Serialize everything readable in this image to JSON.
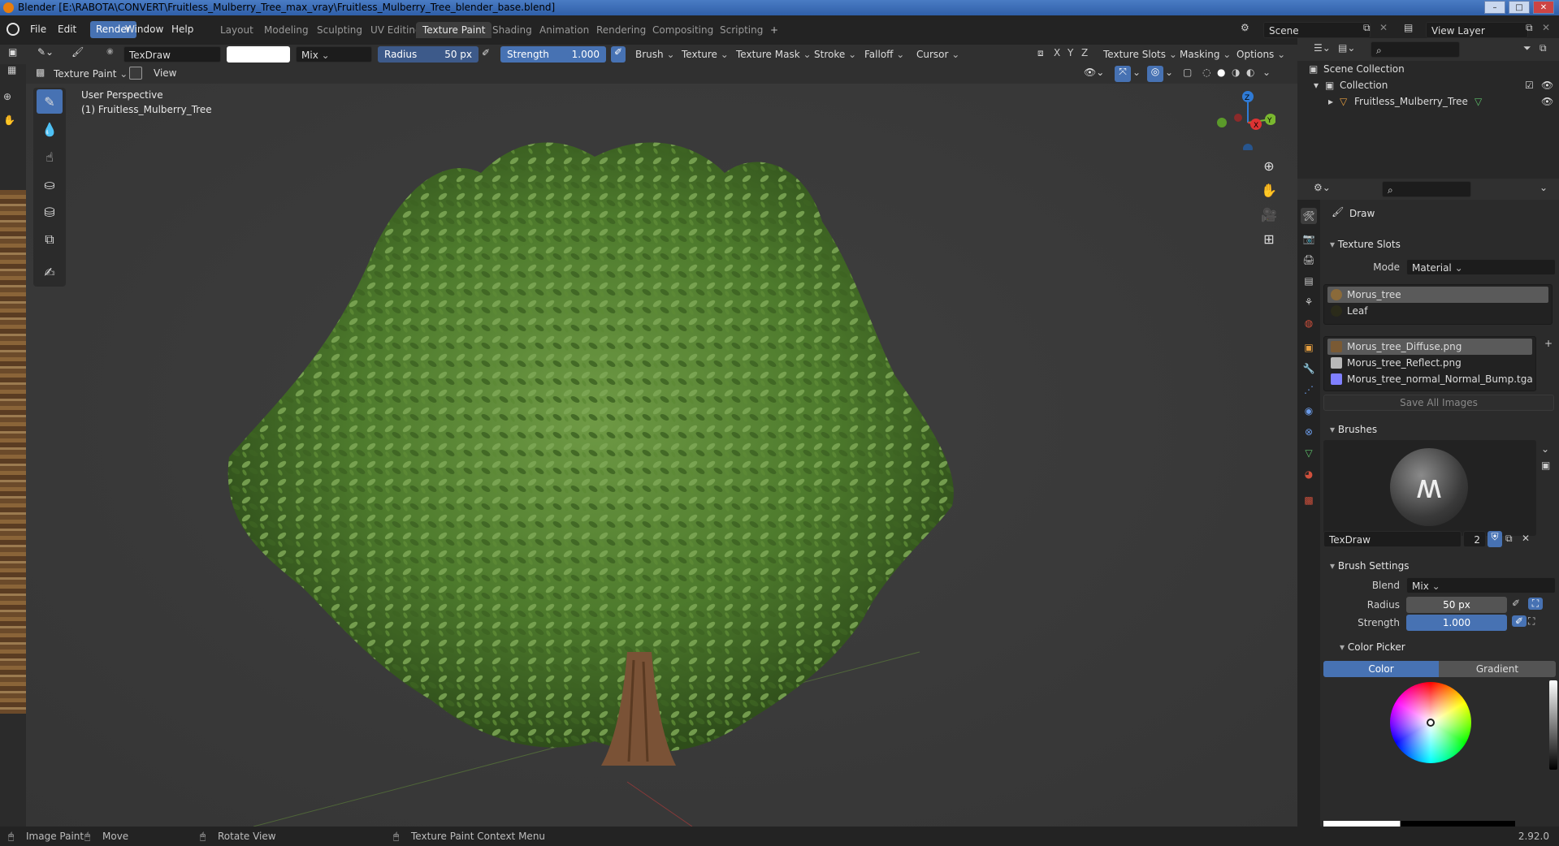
{
  "window": {
    "title": "Blender [E:\\RABOTA\\CONVERT\\Fruitless_Mulberry_Tree_max_vray\\Fruitless_Mulberry_Tree_blender_base.blend]"
  },
  "menu": {
    "items": [
      "File",
      "Edit",
      "Render",
      "Window",
      "Help"
    ],
    "active": "Render"
  },
  "workspaces": {
    "tabs": [
      "Layout",
      "Modeling",
      "Sculpting",
      "UV Editing",
      "Texture Paint",
      "Shading",
      "Animation",
      "Rendering",
      "Compositing",
      "Scripting"
    ],
    "active": "Texture Paint",
    "add": "+"
  },
  "scene": {
    "name": "Scene",
    "view_layer": "View Layer"
  },
  "tool_header": {
    "brush_name": "TexDraw",
    "blend": "Mix",
    "radius_label": "Radius",
    "radius_value": "50 px",
    "strength_label": "Strength",
    "strength_value": "1.000",
    "menus": [
      "Brush",
      "Texture",
      "Texture Mask",
      "Stroke",
      "Falloff",
      "Cursor"
    ],
    "axes": [
      "X",
      "Y",
      "Z"
    ],
    "right_menus": [
      "Texture Slots",
      "Masking",
      "Options"
    ]
  },
  "view_header": {
    "mode": "Texture Paint",
    "view": "View"
  },
  "viewport": {
    "perspective": "User Perspective",
    "object": "(1) Fruitless_Mulberry_Tree",
    "gizmo": {
      "z": "Z",
      "y": "Y",
      "x": "X"
    }
  },
  "outliner": {
    "scene_collection": "Scene Collection",
    "collection": "Collection",
    "object": "Fruitless_Mulberry_Tree"
  },
  "properties": {
    "tool_name": "Draw",
    "texture_slots": {
      "title": "Texture Slots",
      "mode_label": "Mode",
      "mode_value": "Material",
      "materials": [
        {
          "name": "Morus_tree",
          "color": "#8a6a3a"
        },
        {
          "name": "Leaf",
          "color": "#2b2b1a"
        }
      ],
      "images": [
        {
          "name": "Morus_tree_Diffuse.png",
          "color": "#7a5a34"
        },
        {
          "name": "Morus_tree_Reflect.png",
          "color": "#b8b8b8"
        },
        {
          "name": "Morus_tree_normal_Normal_Bump.tga",
          "color": "#8080ff"
        }
      ],
      "save_all": "Save All Images"
    },
    "brushes": {
      "title": "Brushes",
      "name": "TexDraw",
      "users": "2"
    },
    "brush_settings": {
      "title": "Brush Settings",
      "blend_label": "Blend",
      "blend_value": "Mix",
      "radius_label": "Radius",
      "radius_value": "50 px",
      "strength_label": "Strength",
      "strength_value": "1.000"
    },
    "color_picker": {
      "title": "Color Picker",
      "tab_color": "Color",
      "tab_gradient": "Gradient"
    }
  },
  "statusbar": {
    "items": [
      "Image Paint",
      "Move",
      "Rotate View",
      "Texture Paint Context Menu"
    ],
    "version": "2.92.0"
  },
  "colors": {
    "accent": "#4772b3",
    "foliage": "#4d7a2c",
    "trunk": "#7a5236"
  }
}
